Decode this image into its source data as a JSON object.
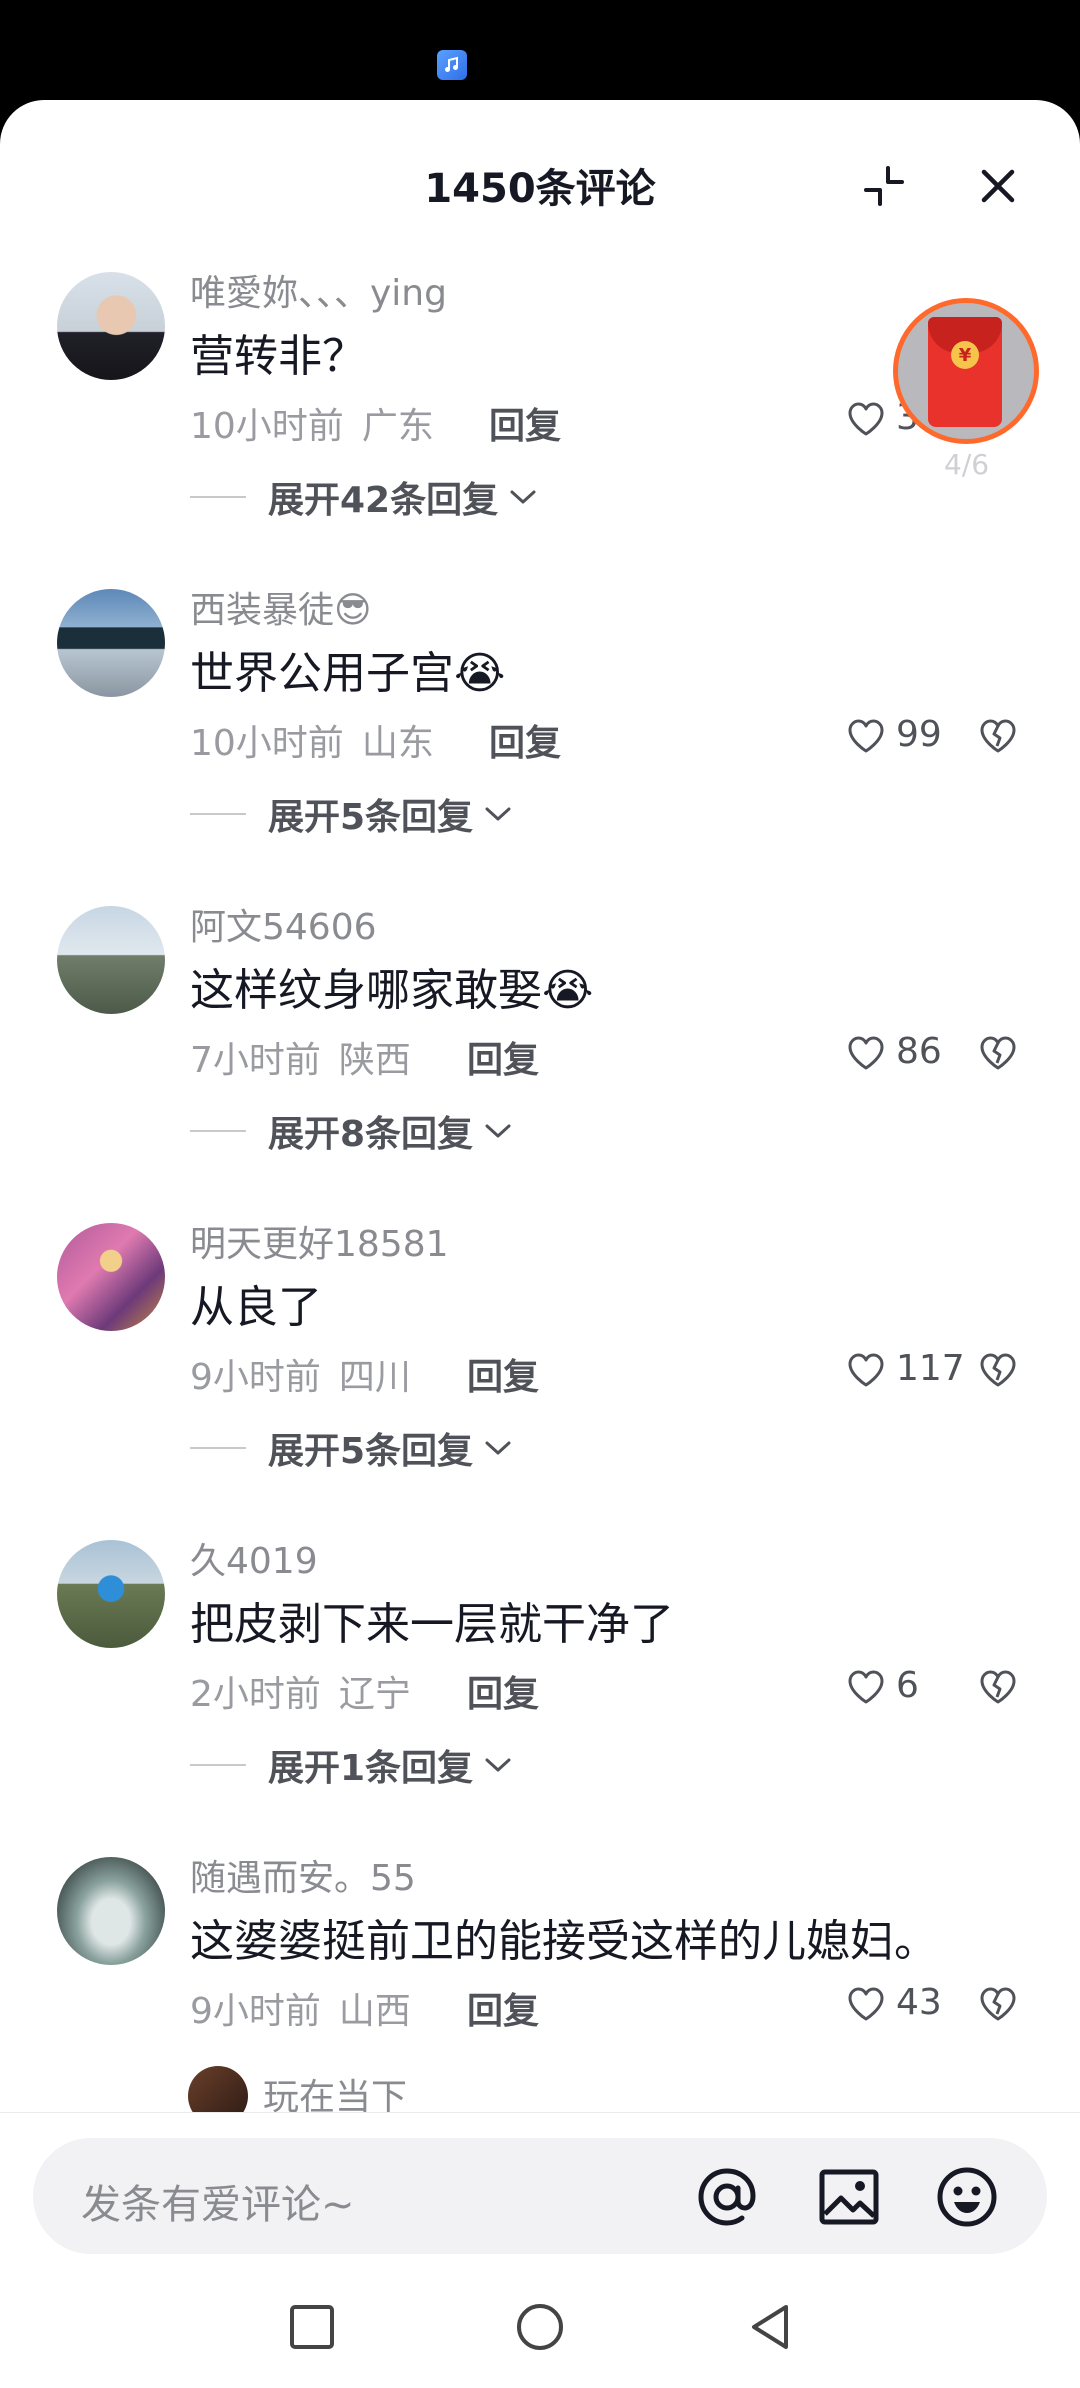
{
  "status_bar": {
    "app_icon": "music-app-icon"
  },
  "header": {
    "title": "1450条评论",
    "collapse_icon": "collapse-icon",
    "close_icon": "close-icon"
  },
  "red_packet": {
    "progress": "4/6",
    "icon": "red-envelope-icon"
  },
  "comments": [
    {
      "name": "唯愛妳、、、ying",
      "text": "营转非？",
      "time": "10小时前",
      "location": "广东",
      "reply": "回复",
      "likes": "396",
      "expand": "展开42条回复"
    },
    {
      "name": "西装暴徒😎",
      "text": "世界公用子宫😭",
      "time": "10小时前",
      "location": "山东",
      "reply": "回复",
      "likes": "99",
      "expand": "展开5条回复"
    },
    {
      "name": "阿文54606",
      "text": "这样纹身哪家敢娶😭",
      "time": "7小时前",
      "location": "陕西",
      "reply": "回复",
      "likes": "86",
      "expand": "展开8条回复"
    },
    {
      "name": "明天更好18581",
      "text": "从良了",
      "time": "9小时前",
      "location": "四川",
      "reply": "回复",
      "likes": "117",
      "expand": "展开5条回复"
    },
    {
      "name": "久4019",
      "text": "把皮剥下来一层就干净了",
      "time": "2小时前",
      "location": "辽宁",
      "reply": "回复",
      "likes": "6",
      "expand": "展开1条回复"
    },
    {
      "name": "随遇而安。55",
      "text": "这婆婆挺前卫的能接受这样的儿媳妇。",
      "time": "9小时前",
      "location": "山西",
      "reply": "回复",
      "likes": "43",
      "expand": ""
    }
  ],
  "partial_comment": {
    "name": "玩在当下"
  },
  "input": {
    "placeholder": "发条有爱评论~",
    "icons": [
      "at-icon",
      "image-icon",
      "emoji-icon"
    ]
  },
  "nav": {
    "icons": [
      "recents-icon",
      "home-icon",
      "back-icon"
    ]
  }
}
